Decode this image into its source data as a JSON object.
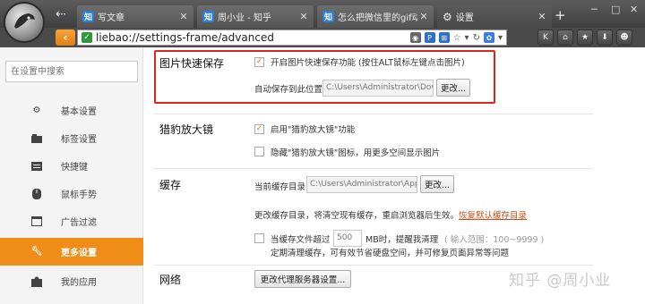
{
  "tabs": [
    {
      "label": "写文章",
      "icon": "知"
    },
    {
      "label": "周小业 - 知乎",
      "icon": "知"
    },
    {
      "label": "怎么把微信里的gif动...",
      "icon": "知"
    },
    {
      "label": "设置",
      "icon": "gear"
    }
  ],
  "address": {
    "url": "liebao://settings-frame/advanced"
  },
  "sidebar": {
    "search_placeholder": "在设置中搜索",
    "items": [
      {
        "label": "基本设置",
        "icon": "gear-icon"
      },
      {
        "label": "标签设置",
        "icon": "tab-icon"
      },
      {
        "label": "快捷键",
        "icon": "keyboard-icon"
      },
      {
        "label": "鼠标手势",
        "icon": "mouse-icon"
      },
      {
        "label": "广告过滤",
        "icon": "window-icon"
      },
      {
        "label": "更多设置",
        "icon": "wrench-icon"
      },
      {
        "label": "我的应用",
        "icon": "puzzle-icon"
      }
    ],
    "active_index": 5
  },
  "image_save": {
    "title": "图片快速保存",
    "checkbox_label": "开启图片快速保存功能 (按住ALT鼠标左键点击图片)",
    "checked": true,
    "path_label": "自动保存到此位置",
    "path_value": "C:\\Users\\Administrator\\Dow",
    "change_button": "更改..."
  },
  "magnifier": {
    "title": "猎豹放大镜",
    "option1": "启用\"猎豹放大镜\"功能",
    "option1_checked": true,
    "option2": "隐藏\"猎豹放大镜\"图标，用更多空间显示图片",
    "option2_checked": false
  },
  "cache": {
    "title": "缓存",
    "dir_label": "当前缓存目录",
    "dir_value": "C:\\Users\\Administrator\\AppD",
    "change_button": "更改...",
    "notice": "更改缓存目录，将清空现有缓存，重启浏览器后生效。",
    "restore_link": "恢复默认缓存目录",
    "limit_prefix": "当缓存文件超过",
    "limit_value": "500",
    "limit_suffix": "MB时，提醒我清理",
    "limit_hint": "( 输入范围：100~9999 )",
    "limit_note": "定期清理缓存，可有效节省硬盘空间，并可修复页面异常等问题",
    "limit_checked": false
  },
  "network": {
    "title": "网络",
    "proxy_button": "更改代理服务器设置..."
  },
  "watermark": "知乎 @周小业",
  "colors": {
    "accent": "#f08c18",
    "highlight_border": "#e0241e",
    "link": "#c8501a"
  }
}
